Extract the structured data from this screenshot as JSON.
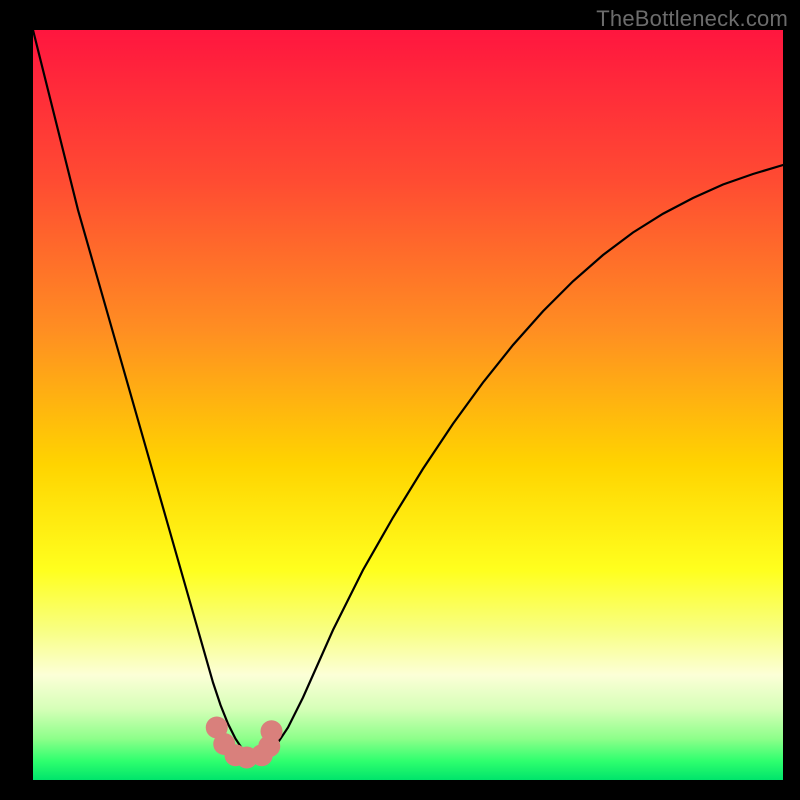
{
  "watermark": "TheBottleneck.com",
  "chart_data": {
    "type": "line",
    "title": "",
    "xlabel": "",
    "ylabel": "",
    "xlim": [
      0,
      100
    ],
    "ylim": [
      0,
      100
    ],
    "grid": false,
    "legend": false,
    "background_gradient_stops": [
      {
        "offset": 0.0,
        "color": "#ff163f"
      },
      {
        "offset": 0.2,
        "color": "#ff4b32"
      },
      {
        "offset": 0.4,
        "color": "#ff8e22"
      },
      {
        "offset": 0.58,
        "color": "#ffd400"
      },
      {
        "offset": 0.72,
        "color": "#ffff1e"
      },
      {
        "offset": 0.8,
        "color": "#f8ff82"
      },
      {
        "offset": 0.86,
        "color": "#fcffd7"
      },
      {
        "offset": 0.905,
        "color": "#d6ffb8"
      },
      {
        "offset": 0.945,
        "color": "#8dff8a"
      },
      {
        "offset": 0.975,
        "color": "#2eff6e"
      },
      {
        "offset": 1.0,
        "color": "#00e46b"
      }
    ],
    "series": [
      {
        "name": "bottleneck-curve",
        "stroke": "#000000",
        "stroke_width": 2.2,
        "x": [
          0,
          2,
          4,
          6,
          8,
          10,
          12,
          14,
          16,
          18,
          20,
          22,
          24,
          25,
          26,
          27,
          28,
          29,
          30,
          31,
          32,
          34,
          36,
          38,
          40,
          44,
          48,
          52,
          56,
          60,
          64,
          68,
          72,
          76,
          80,
          84,
          88,
          92,
          96,
          100
        ],
        "y": [
          100,
          92,
          84,
          76,
          69,
          62,
          55,
          48,
          41,
          34,
          27,
          20,
          13,
          10,
          7.5,
          5.5,
          4,
          3.2,
          3,
          3.2,
          4,
          7,
          11,
          15.5,
          20,
          28,
          35,
          41.5,
          47.5,
          53,
          58,
          62.5,
          66.5,
          70,
          73,
          75.5,
          77.6,
          79.4,
          80.8,
          82
        ]
      },
      {
        "name": "marker-dots",
        "type": "scatter",
        "color": "#d9807c",
        "radius": 11,
        "x": [
          24.5,
          25.5,
          27.0,
          28.5,
          30.5,
          31.5,
          31.8
        ],
        "y": [
          7.0,
          4.8,
          3.3,
          3.0,
          3.3,
          4.5,
          6.5
        ]
      }
    ]
  }
}
